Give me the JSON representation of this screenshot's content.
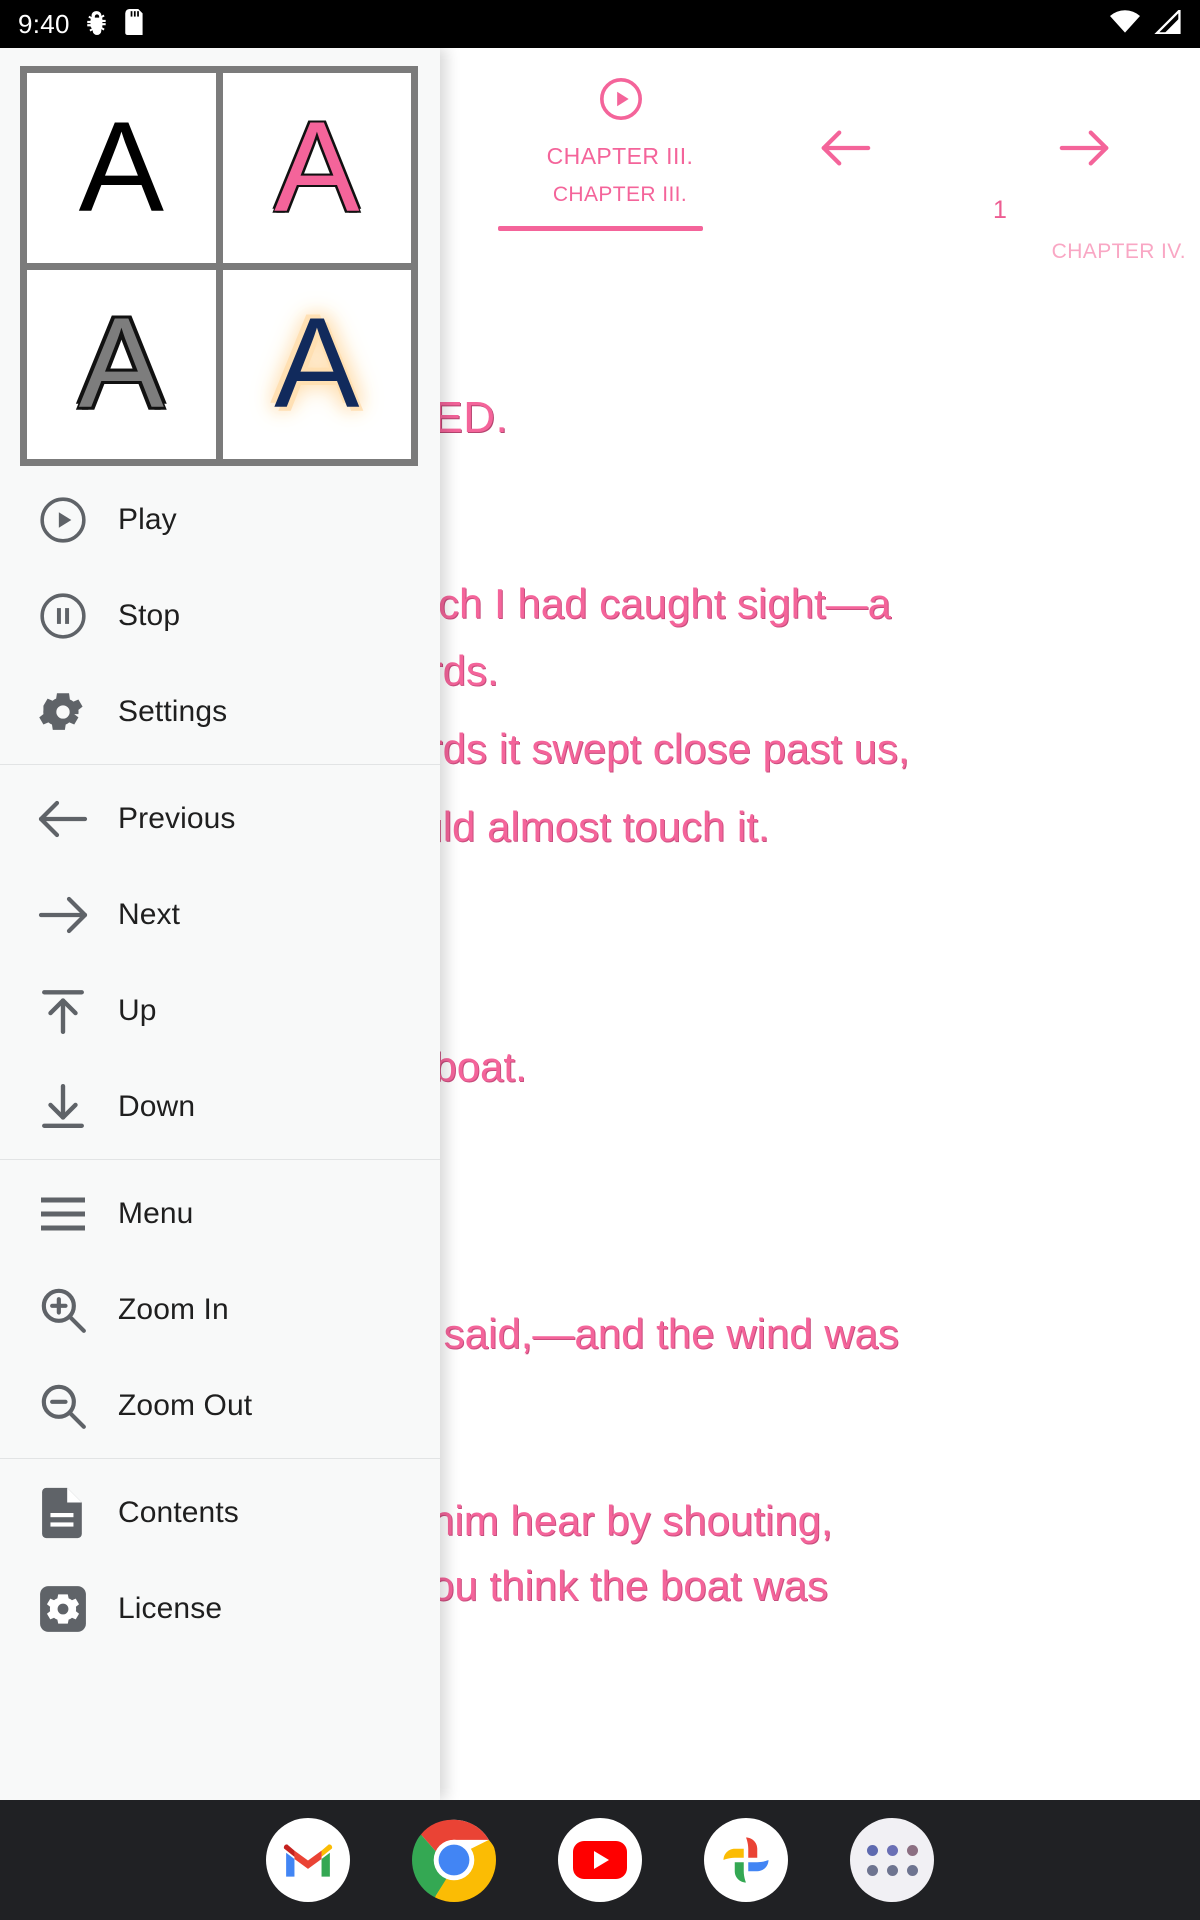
{
  "status_bar": {
    "clock": "9:40",
    "left_icons": [
      "bug-icon",
      "sd-card-icon"
    ],
    "right_icons": [
      "wifi-icon",
      "cell-signal-icon"
    ]
  },
  "reader": {
    "top_nav": {
      "play_icon": "play-circle-icon",
      "play_label": "CHAPTER III.",
      "current_chapter": "CHAPTER III.",
      "prev_icon": "arrow-left-icon",
      "next_icon": "arrow-right-icon",
      "page_number": "1",
      "next_chapter": "CHAPTER IV."
    },
    "heading": "AVED.",
    "lines": [
      "which I had caught sight—a",
      "wards.",
      "wards it swept close past us,",
      "could almost touch it.",
      "eir boat.",
      "'",
      "r!' I said,—and the wind was",
      "ke him hear by shouting,",
      "o you think the boat was"
    ]
  },
  "drawer": {
    "preview": {
      "title": "font-style-preview",
      "cells": [
        {
          "letter": "A",
          "style": "plain-black"
        },
        {
          "letter": "A",
          "style": "pink-outline"
        },
        {
          "letter": "A",
          "style": "gray-outline"
        },
        {
          "letter": "A",
          "style": "navy-glow"
        }
      ]
    },
    "groups": [
      {
        "items": [
          {
            "label": "Play",
            "icon": "play-circle-icon"
          },
          {
            "label": "Stop",
            "icon": "pause-circle-icon"
          },
          {
            "label": "Settings",
            "icon": "gear-icon"
          }
        ]
      },
      {
        "items": [
          {
            "label": "Previous",
            "icon": "arrow-left-icon"
          },
          {
            "label": "Next",
            "icon": "arrow-right-icon"
          },
          {
            "label": "Up",
            "icon": "arrow-to-top-icon"
          },
          {
            "label": "Down",
            "icon": "arrow-to-bottom-icon"
          }
        ]
      },
      {
        "items": [
          {
            "label": "Menu",
            "icon": "hamburger-menu-icon"
          },
          {
            "label": "Zoom In",
            "icon": "magnifier-plus-icon"
          },
          {
            "label": "Zoom Out",
            "icon": "magnifier-minus-icon"
          }
        ]
      },
      {
        "items": [
          {
            "label": "Contents",
            "icon": "document-icon"
          },
          {
            "label": "License",
            "icon": "settings-square-icon"
          }
        ]
      }
    ]
  },
  "dock": {
    "apps": [
      {
        "name": "gmail-icon"
      },
      {
        "name": "chrome-icon"
      },
      {
        "name": "youtube-icon"
      },
      {
        "name": "google-photos-icon"
      },
      {
        "name": "all-apps-icon"
      }
    ]
  },
  "colors": {
    "accent_pink": "#f4649a",
    "accent_pink_light": "#f9a7c4",
    "drawer_bg": "#f8f9f9",
    "dock_bg": "#202124",
    "icon_gray": "#5f6368"
  }
}
